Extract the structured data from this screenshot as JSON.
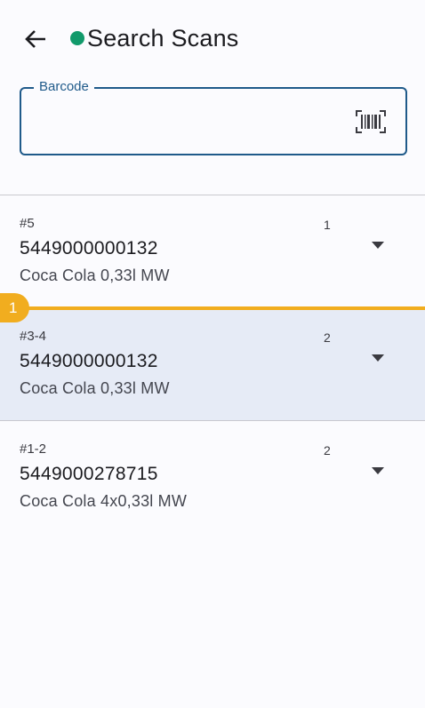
{
  "app_bar": {
    "back_icon": "arrow-left-icon",
    "title": "Search Scans",
    "status_color": "#119a6b"
  },
  "search": {
    "label": "Barcode",
    "value": "",
    "scan_icon": "barcode-scan-icon",
    "accent": "#1f5a8a"
  },
  "rows": [
    {
      "range": "#5",
      "count": "1",
      "barcode": "5449000000132",
      "name": "Coca Cola 0,33l MW",
      "selected": false
    },
    {
      "range": "#3-4",
      "count": "2",
      "barcode": "5449000000132",
      "name": "Coca Cola 0,33l MW",
      "selected": true
    },
    {
      "range": "#1-2",
      "count": "2",
      "barcode": "5449000278715",
      "name": "Coca Cola 4x0,33l MW",
      "selected": false
    }
  ],
  "drop_indicator": {
    "label": "1",
    "color": "#f1ad1f"
  },
  "colors": {
    "selected_row": "#e6ebf6",
    "background": "#fbfbfe"
  }
}
